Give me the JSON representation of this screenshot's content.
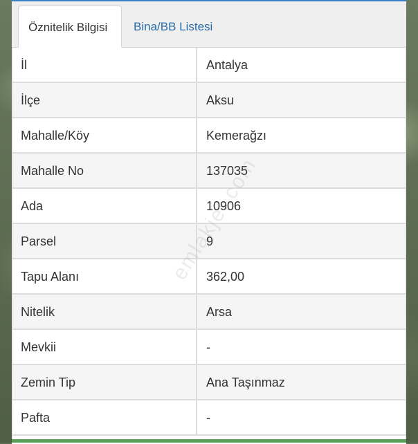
{
  "tabs": [
    {
      "label": "Öznitelik Bilgisi",
      "active": true
    },
    {
      "label": "Bina/BB Listesi",
      "active": false
    }
  ],
  "rows": [
    {
      "key": "İl",
      "value": "Antalya"
    },
    {
      "key": "İlçe",
      "value": "Aksu"
    },
    {
      "key": "Mahalle/Köy",
      "value": "Kemerağzı"
    },
    {
      "key": "Mahalle No",
      "value": "137035"
    },
    {
      "key": "Ada",
      "value": "10906"
    },
    {
      "key": "Parsel",
      "value": "9"
    },
    {
      "key": "Tapu Alanı",
      "value": "362,00"
    },
    {
      "key": "Nitelik",
      "value": "Arsa"
    },
    {
      "key": "Mevkii",
      "value": "-"
    },
    {
      "key": "Zemin Tip",
      "value": "Ana Taşınmaz"
    },
    {
      "key": "Pafta",
      "value": "-"
    }
  ],
  "watermark": "emlakjet.com",
  "colors": {
    "accent": "#3d7fc1",
    "tab_link": "#2b6ca8"
  }
}
